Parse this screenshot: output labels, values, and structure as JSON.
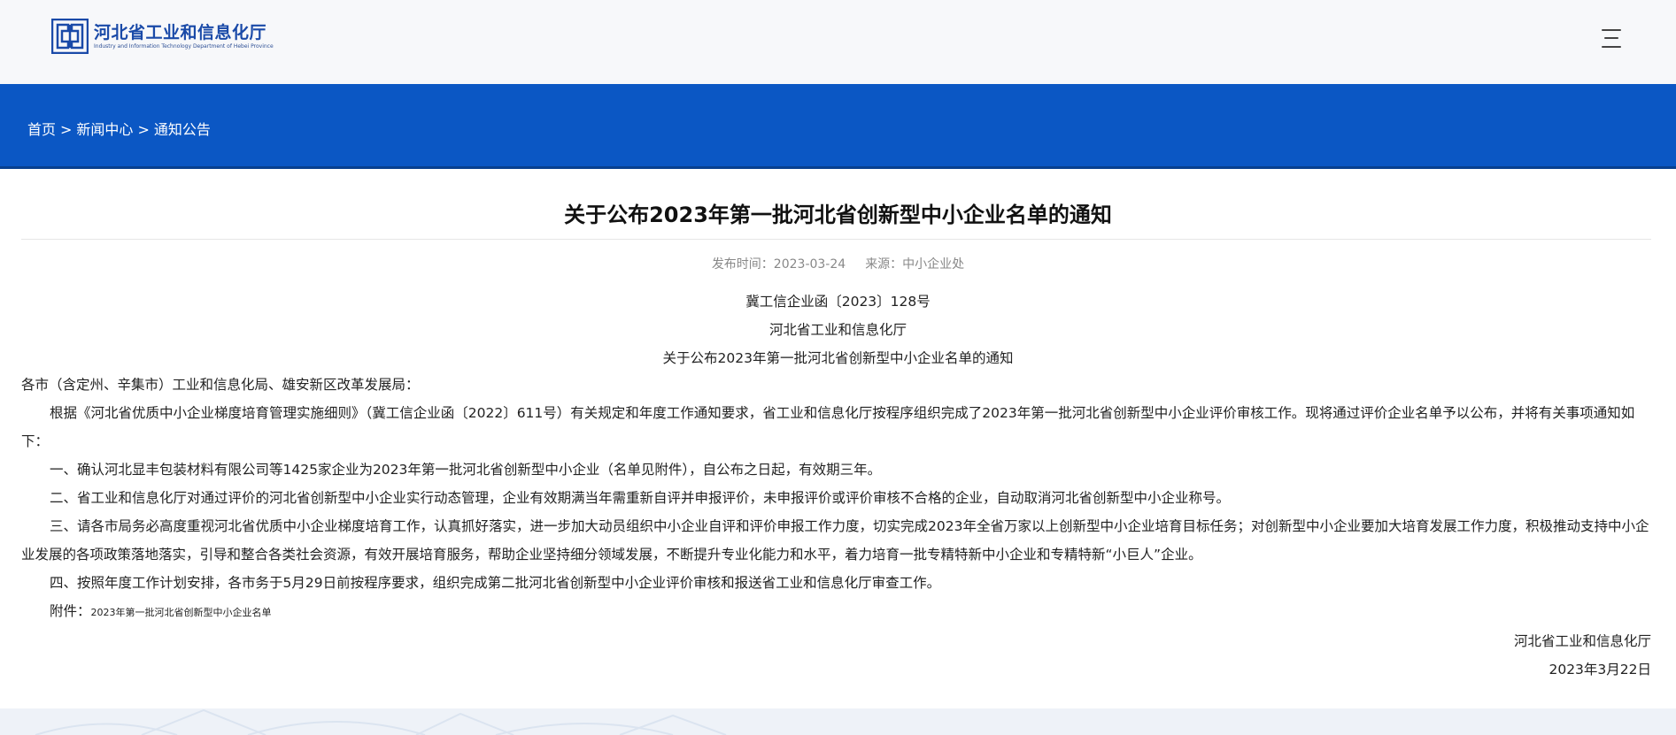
{
  "header": {
    "logo_cn": "河北省工业和信息化厅",
    "logo_en": "Industry and Information Technology Department of Hebei Province",
    "brand_color": "#1a4aa8",
    "menu_icon": "hamburger-menu-icon"
  },
  "banner": {
    "color": "#0b57c4",
    "breadcrumb": {
      "home": "首页",
      "section": "新闻中心",
      "current": "通知公告",
      "separator": ">"
    }
  },
  "article": {
    "title": "关于公布2023年第一批河北省创新型中小企业名单的通知",
    "publish_time_label": "发布时间：2023-03-24",
    "source_label": "来源：中小企业处",
    "doc_number": "冀工信企业函〔2023〕128号",
    "issuer": "河北省工业和信息化厅",
    "subtitle": "关于公布2023年第一批河北省创新型中小企业名单的通知",
    "salutation": "各市（含定州、辛集市）工业和信息化局、雄安新区改革发展局：",
    "intro": "根据《河北省优质中小企业梯度培育管理实施细则》（冀工信企业函〔2022〕611号）有关规定和年度工作通知要求，省工业和信息化厅按程序组织完成了2023年第一批河北省创新型中小企业评价审核工作。现将通过评价企业名单予以公布，并将有关事项通知如下：",
    "item1": "一、确认河北显丰包装材料有限公司等1425家企业为2023年第一批河北省创新型中小企业（名单见附件），自公布之日起，有效期三年。",
    "item2": "二、省工业和信息化厅对通过评价的河北省创新型中小企业实行动态管理，企业有效期满当年需重新自评并申报评价，未申报评价或评价审核不合格的企业，自动取消河北省创新型中小企业称号。",
    "item3": "三、请各市局务必高度重视河北省优质中小企业梯度培育工作，认真抓好落实，进一步加大动员组织中小企业自评和评价申报工作力度，切实完成2023年全省万家以上创新型中小企业培育目标任务；对创新型中小企业要加大培育发展工作力度，积极推动支持中小企业发展的各项政策落地落实，引导和整合各类社会资源，有效开展培育服务，帮助企业坚持细分领域发展，不断提升专业化能力和水平，着力培育一批专精特新中小企业和专精特新“小巨人”企业。",
    "item4": "四、按照年度工作计划安排，各市务于5月29日前按程序要求，组织完成第二批河北省创新型中小企业评价审核和报送省工业和信息化厅审查工作。",
    "attachment_label": "附件：",
    "attachment_link": "2023年第一批河北省创新型中小企业名单",
    "signature": "河北省工业和信息化厅",
    "date": "2023年3月22日"
  }
}
